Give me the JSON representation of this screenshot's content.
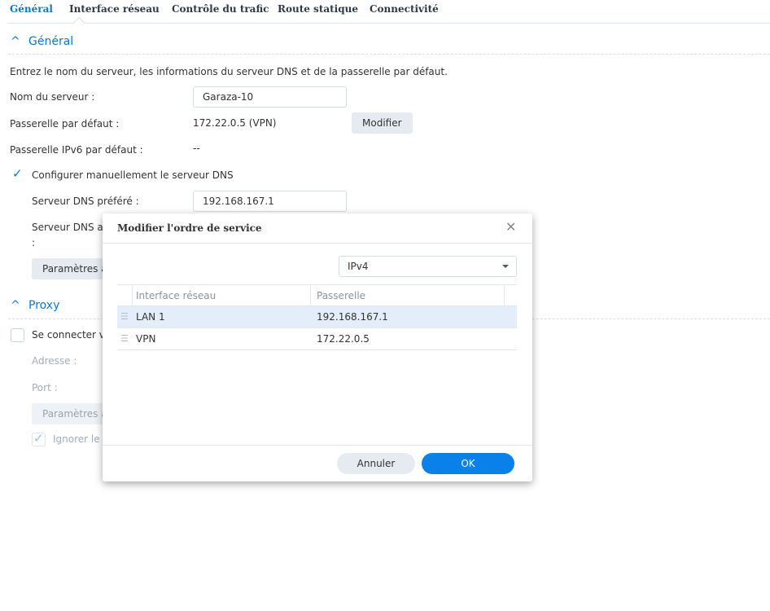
{
  "tabs": [
    {
      "label": "Général",
      "active": true
    },
    {
      "label": "Interface réseau"
    },
    {
      "label": "Contrôle du trafic"
    },
    {
      "label": "Route statique"
    },
    {
      "label": "Connectivité"
    }
  ],
  "general": {
    "section_title": "Général",
    "description": "Entrez le nom du serveur, les informations du serveur DNS et de la passerelle par défaut.",
    "server_name_label": "Nom du serveur :",
    "server_name_value": "Garaza-10",
    "gateway_label": "Passerelle par défaut :",
    "gateway_value": "172.22.0.5 (VPN)",
    "modify_label": "Modifier",
    "ipv6_gateway_label": "Passerelle IPv6 par défaut :",
    "ipv6_gateway_value": "--",
    "manual_dns_label": "Configurer manuellement le serveur DNS",
    "manual_dns_checked": true,
    "preferred_dns_label": "Serveur DNS préféré :",
    "preferred_dns_value": "192.168.167.1",
    "alternate_dns_label": "Serveur DNS alternatif",
    "alternate_dns_colon": ":",
    "advanced_label": "Paramètres avancés"
  },
  "proxy": {
    "section_title": "Proxy",
    "connect_label": "Se connecter via un serveur proxy",
    "connect_checked": false,
    "address_label": "Adresse :",
    "port_label": "Port :",
    "advanced_label": "Paramètres avancés",
    "bypass_label": "Ignorer le serveur proxy pour les adresses locales",
    "bypass_checked": true
  },
  "dialog": {
    "title": "Modifier l'ordre de service",
    "close_icon": "close-icon",
    "select_value": "IPv4",
    "columns": [
      "Interface réseau",
      "Passerelle"
    ],
    "rows": [
      {
        "interface": "LAN 1",
        "gateway": "192.168.167.1",
        "selected": true
      },
      {
        "interface": "VPN",
        "gateway": "172.22.0.5"
      }
    ],
    "cancel_label": "Annuler",
    "ok_label": "OK"
  },
  "colors": {
    "accent": "#0a78d6",
    "selected_row": "#e4eefa"
  }
}
